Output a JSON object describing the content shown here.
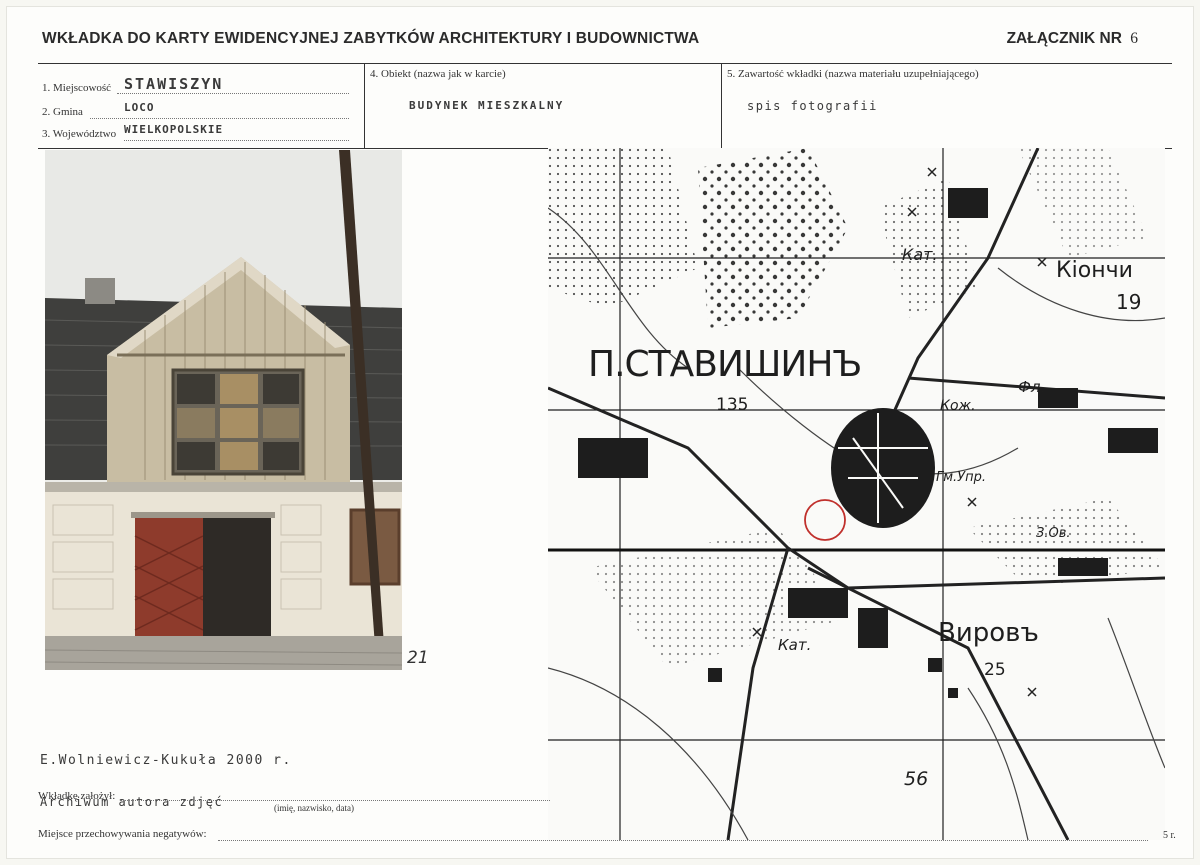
{
  "header": {
    "title": "WKŁADKA DO KARTY EWIDENCYJNEJ ZABYTKÓW ARCHITEKTURY I BUDOWNICTWA",
    "annex_label": "ZAŁĄCZNIK NR",
    "annex_number": "6"
  },
  "fields": {
    "locality_label": "1. Miejscowość",
    "locality_value": "STAWISZYN",
    "commune_label": "2. Gmina",
    "commune_value": "LOCO",
    "voivodeship_label": "3. Województwo",
    "voivodeship_value": "WIELKOPOLSKIE",
    "object_label": "4. Obiekt (nazwa jak w karcie)",
    "object_value": "BUDYNEK MIESZKALNY",
    "contents_label": "5. Zawartość wkładki (nazwa materiału uzupełniającego)",
    "contents_value": "spis fotografii"
  },
  "photo": {
    "number": "21"
  },
  "map": {
    "labels": {
      "town": "П.СТАВИШИНЪ",
      "town_num": "135",
      "kionchin": "Кіончи",
      "num_19": "19",
      "virov": "Вировъ",
      "num_25": "25",
      "num_56": "56",
      "kat1": "Кат.",
      "kat2": "Кат.",
      "fl": "Фл.",
      "koj": "Кож.",
      "gm_upr": "Гм.Упр.",
      "zav": "З.Ов."
    }
  },
  "footer": {
    "author_typed": "E.Wolniewicz-Kukuła 2000 r.",
    "prepared_label": "Wkładkę założył:",
    "prepared_typed": "Archiwum autora zdjęć",
    "prepared_hint": "(imię, nazwisko, data)",
    "storage_label": "Miejsce przechowywania negatywów:",
    "page_mark": "5 r."
  },
  "colors": {
    "ink": "#222222",
    "red_marker": "#c0302c",
    "door_red": "#8e3b2c"
  }
}
